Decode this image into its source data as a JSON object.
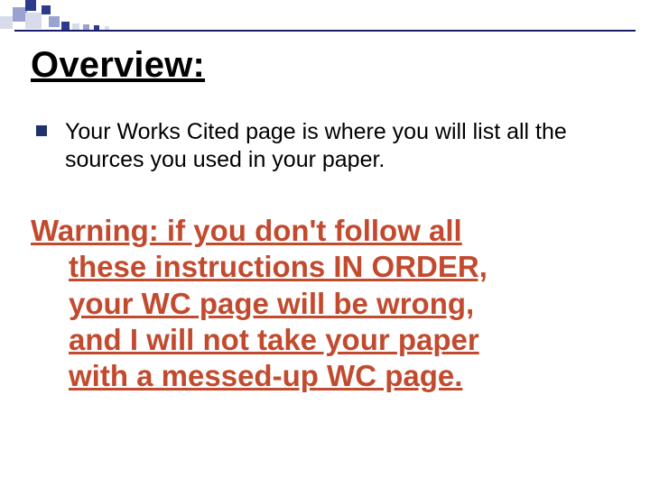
{
  "heading": "Overview:",
  "bullet_text": "Your Works Cited page is where you will list all the sources you used in your paper.",
  "warning_line1": "Warning: if you don't follow all",
  "warning_line2": "these instructions IN ORDER,",
  "warning_line3": "your WC page will be wrong,",
  "warning_line4": "and I will not take your paper",
  "warning_line5": "with a messed-up WC page."
}
